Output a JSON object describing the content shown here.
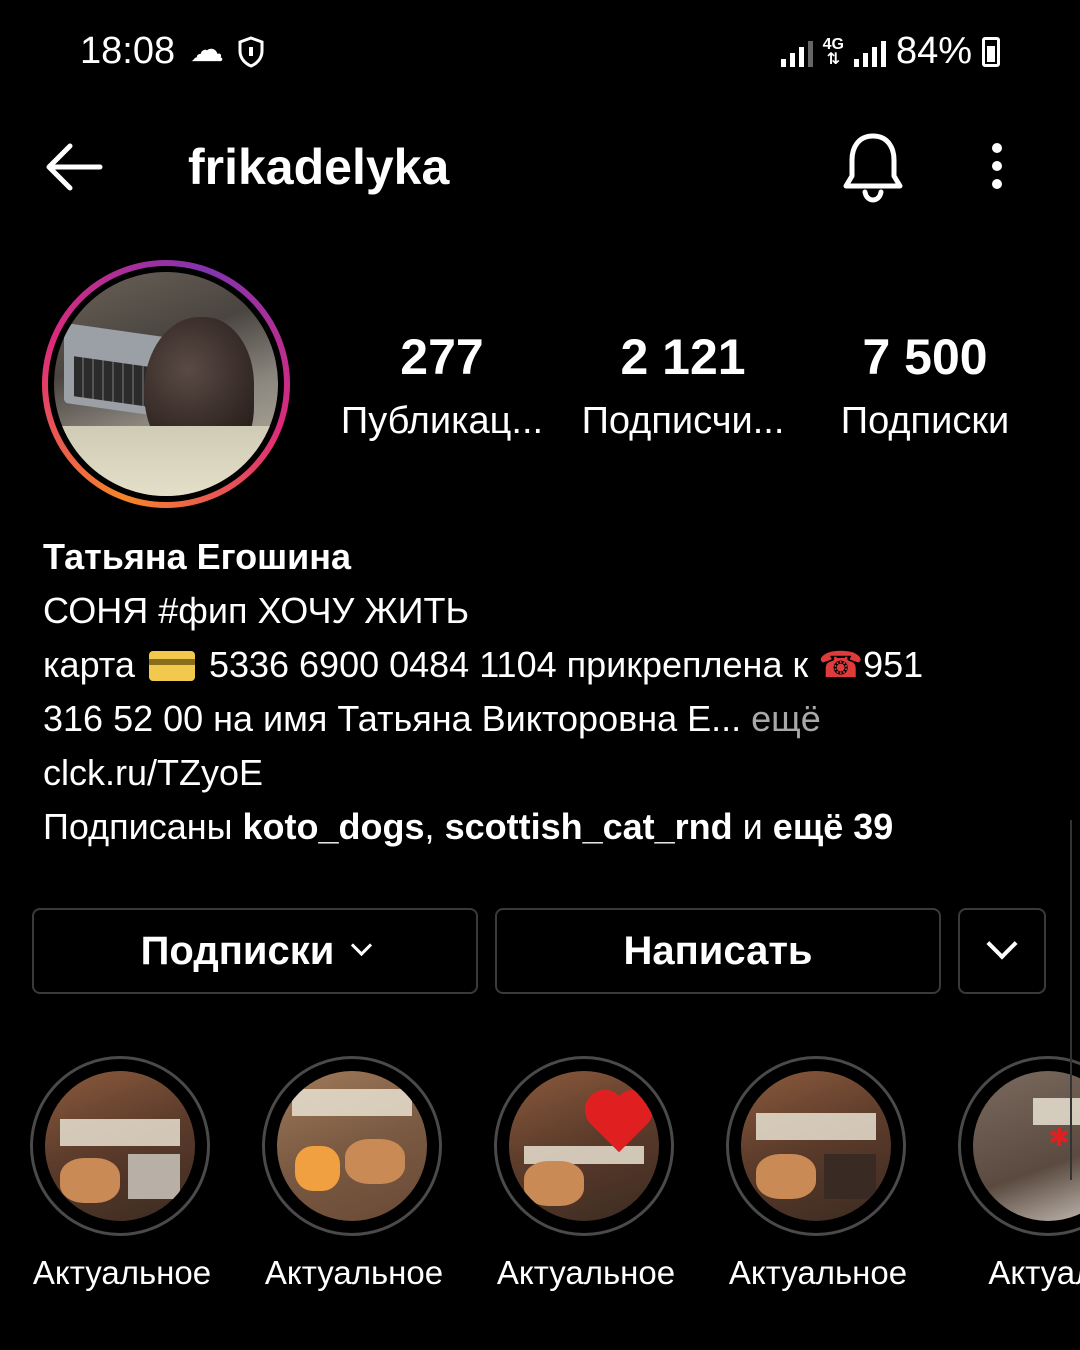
{
  "status_bar": {
    "time": "18:08",
    "weather_icon": "☁",
    "network": "4G",
    "battery": "84%"
  },
  "header": {
    "username": "frikadelyka"
  },
  "stats": [
    {
      "value": "277",
      "label": "Публикац..."
    },
    {
      "value": "2 121",
      "label": "Подписчи..."
    },
    {
      "value": "7 500",
      "label": "Подписки"
    }
  ],
  "bio": {
    "name": "Татьяна Егошина",
    "line1": "СОНЯ #фип ХОЧУ ЖИТЬ",
    "line2_a": "карта",
    "line2_b": "5336 6900 0484 1104 прикреплена к",
    "phone_emoji": "☎",
    "line2_c": "951",
    "line3": "316 52 00 на имя Татьяна Викторовна Е...",
    "more": "ещё",
    "link": "clck.ru/TZyoE",
    "followed_prefix": "Подписаны",
    "followed_user1": "koto_dogs",
    "sep": ",",
    "followed_user2": "scottish_cat_rnd",
    "followed_mid": "и",
    "followed_more": "ещё 39"
  },
  "buttons": {
    "following": "Подписки",
    "message": "Написать"
  },
  "highlights": [
    {
      "label": "Актуальное"
    },
    {
      "label": "Актуальное"
    },
    {
      "label": "Актуальное"
    },
    {
      "label": "Актуальное"
    },
    {
      "label": "Актуаль"
    }
  ],
  "colors": {
    "background": "#000000",
    "muted": "#a8a8a8",
    "ring_gradient": [
      "#f58529",
      "#dd2a7b",
      "#8134af"
    ]
  }
}
